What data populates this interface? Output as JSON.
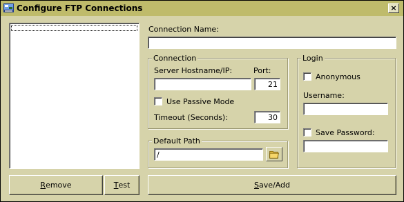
{
  "window": {
    "title": "Configure FTP Connections",
    "close_label": "×"
  },
  "connection_name": {
    "label": "Connection Name:",
    "value": ""
  },
  "connection_group": {
    "label": "Connection",
    "hostname_label": "Server Hostname/IP:",
    "hostname_value": "",
    "port_label": "Port:",
    "port_value": "21",
    "passive_label": "Use Passive Mode",
    "passive_checked": false,
    "timeout_label": "Timeout (Seconds):",
    "timeout_value": "30"
  },
  "default_path_group": {
    "label": "Default Path",
    "value": "/"
  },
  "login_group": {
    "label": "Login",
    "anonymous_label": "Anonymous",
    "anonymous_checked": false,
    "username_label": "Username:",
    "username_value": "",
    "save_password_label": "Save Password:",
    "save_password_checked": false,
    "password_value": ""
  },
  "buttons": {
    "remove": {
      "first": "R",
      "rest": "emove"
    },
    "test": {
      "first": "T",
      "rest": "est"
    },
    "save_add": {
      "first": "S",
      "rest": "ave/Add"
    }
  },
  "connections_list": {
    "items": []
  },
  "icons": {
    "app": "ftp-app-icon",
    "close": "close-icon",
    "browse": "folder-icon"
  }
}
